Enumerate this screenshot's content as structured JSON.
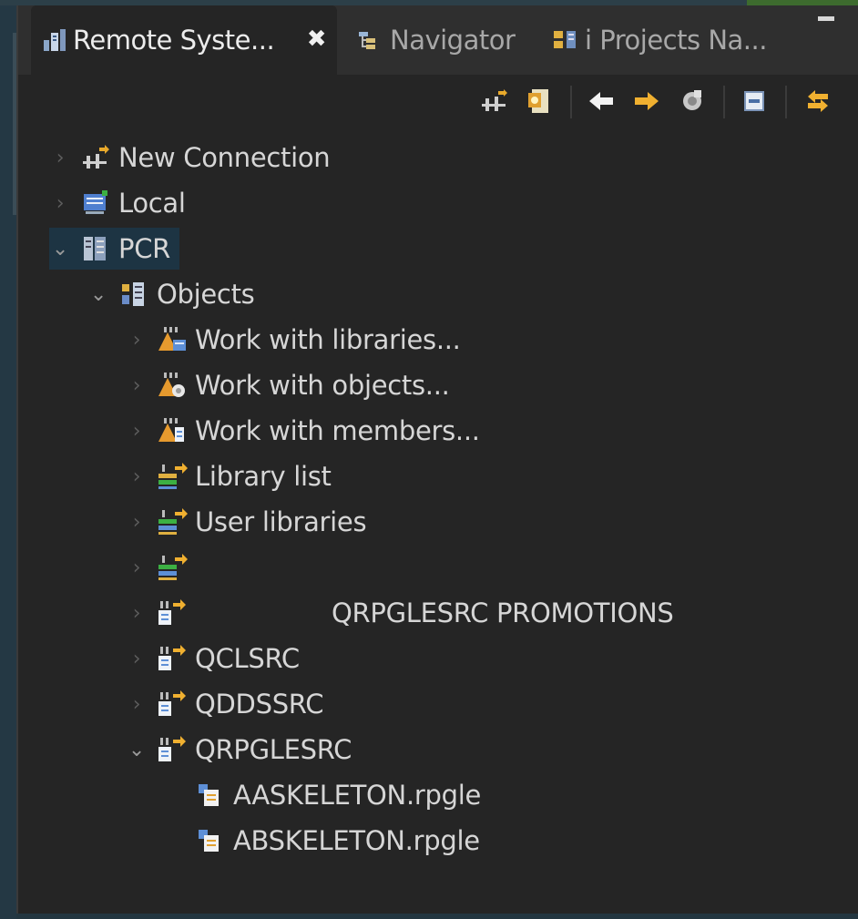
{
  "tabs": [
    {
      "label": "Remote Syste...",
      "icon": "remote-systems-icon",
      "active": true
    },
    {
      "label": "Navigator",
      "icon": "navigator-icon",
      "active": false
    },
    {
      "label": "i Projects Na...",
      "icon": "i-projects-icon",
      "active": false
    }
  ],
  "tab_close": "✖",
  "toolbar": {
    "buttons": [
      "new-connection-icon",
      "import-icon",
      "back-arrow-icon",
      "forward-arrow-icon",
      "refresh-icon",
      "collapse-all-icon",
      "link-with-editor-icon"
    ]
  },
  "tree": [
    {
      "label": "New Connection",
      "icon": "new-connection-icon",
      "twisty": "collapsed",
      "depth": 0
    },
    {
      "label": "Local",
      "icon": "local-icon",
      "twisty": "collapsed",
      "depth": 0
    },
    {
      "label": "PCR",
      "icon": "system-icon",
      "twisty": "expanded",
      "depth": 0,
      "selected": true
    },
    {
      "label": "Objects",
      "icon": "objects-subsystem-icon",
      "twisty": "expanded",
      "depth": 1
    },
    {
      "label": "Work with libraries...",
      "icon": "work-with-libraries-icon",
      "twisty": "collapsed",
      "depth": 2
    },
    {
      "label": "Work with objects...",
      "icon": "work-with-objects-icon",
      "twisty": "collapsed",
      "depth": 2
    },
    {
      "label": "Work with members...",
      "icon": "work-with-members-icon",
      "twisty": "collapsed",
      "depth": 2
    },
    {
      "label": "Library list",
      "icon": "library-list-icon",
      "twisty": "collapsed",
      "depth": 2
    },
    {
      "label": "User libraries",
      "icon": "user-libraries-icon",
      "twisty": "collapsed",
      "depth": 2
    },
    {
      "label": "",
      "icon": "filter-icon",
      "twisty": "collapsed",
      "depth": 2
    },
    {
      "label": "QRPGLESRC PROMOTIONS",
      "icon": "source-filter-icon",
      "twisty": "collapsed",
      "depth": 2,
      "redacted_prefix": true
    },
    {
      "label": "QCLSRC",
      "icon": "source-filter-icon",
      "twisty": "collapsed",
      "depth": 2
    },
    {
      "label": "QDDSSRC",
      "icon": "source-filter-icon",
      "twisty": "collapsed",
      "depth": 2
    },
    {
      "label": "QRPGLESRC",
      "icon": "source-filter-icon",
      "twisty": "expanded",
      "depth": 2
    },
    {
      "label": "AASKELETON.rpgle",
      "icon": "member-file-icon",
      "twisty": "none",
      "depth": 3
    },
    {
      "label": "ABSKELETON.rpgle",
      "icon": "member-file-icon",
      "twisty": "none",
      "depth": 3
    }
  ]
}
